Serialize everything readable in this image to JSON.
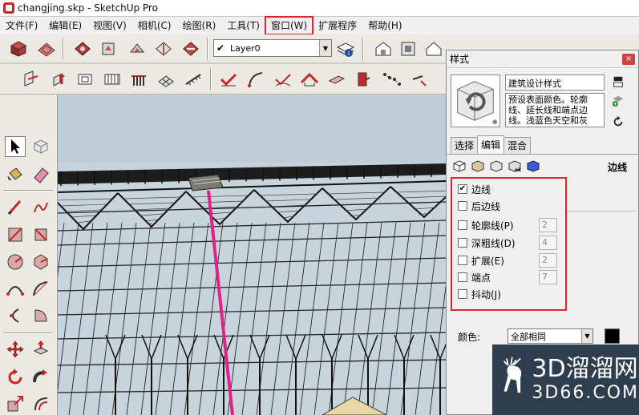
{
  "window": {
    "title": "changjing.skp - SketchUp Pro"
  },
  "menu": [
    {
      "label": "文件(F)"
    },
    {
      "label": "编辑(E)"
    },
    {
      "label": "视图(V)"
    },
    {
      "label": "相机(C)"
    },
    {
      "label": "绘图(R)"
    },
    {
      "label": "工具(T)"
    },
    {
      "label": "窗口(W)",
      "highlight": true
    },
    {
      "label": "扩展程序"
    },
    {
      "label": "帮助(H)"
    }
  ],
  "layer": {
    "check": "✔",
    "current": "Layer0"
  },
  "styles_panel": {
    "title": "样式",
    "close": "×",
    "style_name": "建筑设计样式",
    "description": "预设表面颜色。轮廓线、延长线和端点边线。浅蓝色天空和灰",
    "tabs": [
      "选择",
      "编辑",
      "混合"
    ],
    "active_tab": 1,
    "section_label": "边线",
    "options": [
      {
        "label": "边线",
        "checked": true,
        "value": ""
      },
      {
        "label": "后边线",
        "checked": false,
        "value": ""
      },
      {
        "label": "轮廓线(P)",
        "checked": false,
        "value": "2"
      },
      {
        "label": "深粗线(D)",
        "checked": false,
        "value": "4"
      },
      {
        "label": "扩展(E)",
        "checked": false,
        "value": "2"
      },
      {
        "label": "端点",
        "checked": false,
        "value": "7"
      },
      {
        "label": "抖动(J)",
        "checked": false,
        "value": ""
      }
    ],
    "color_label": "颜色:",
    "color_value": "全部相同",
    "color_swatch": "#000000"
  },
  "watermark": {
    "line1": "3D溜溜网",
    "line2": "3D66.COM"
  },
  "colors": {
    "highlight": "#e0262b",
    "pink_line": "#e0218a",
    "sky": "#c6d3dc"
  }
}
